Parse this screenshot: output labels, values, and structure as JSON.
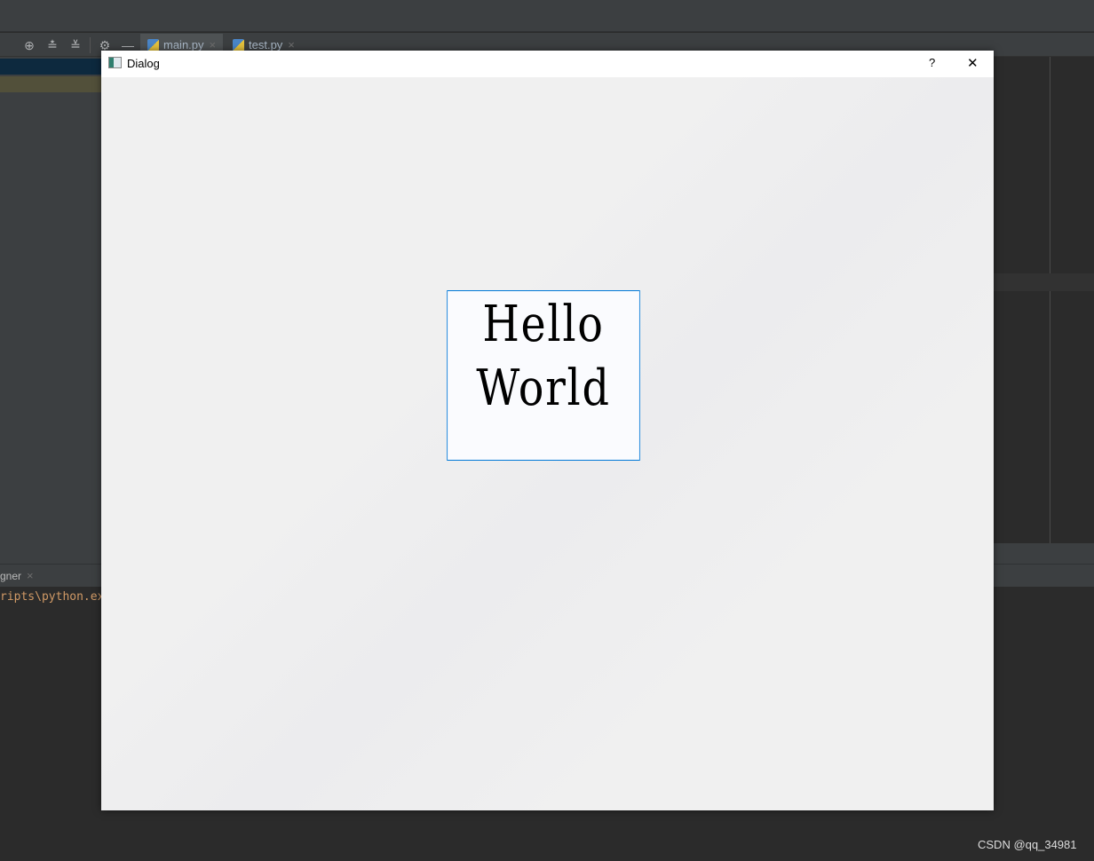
{
  "ide": {
    "tabs": [
      {
        "label": "main.py"
      },
      {
        "label": "test.py"
      }
    ],
    "bottom_tab": "gner",
    "console_text": "ripts\\python.ex",
    "close_glyph": "×"
  },
  "dialog": {
    "title": "Dialog",
    "help_button": "?",
    "close_button": "✕",
    "label_text": "Hello World",
    "label_lines": [
      "Hello",
      "World"
    ]
  },
  "watermark": "CSDN @qq_34981"
}
